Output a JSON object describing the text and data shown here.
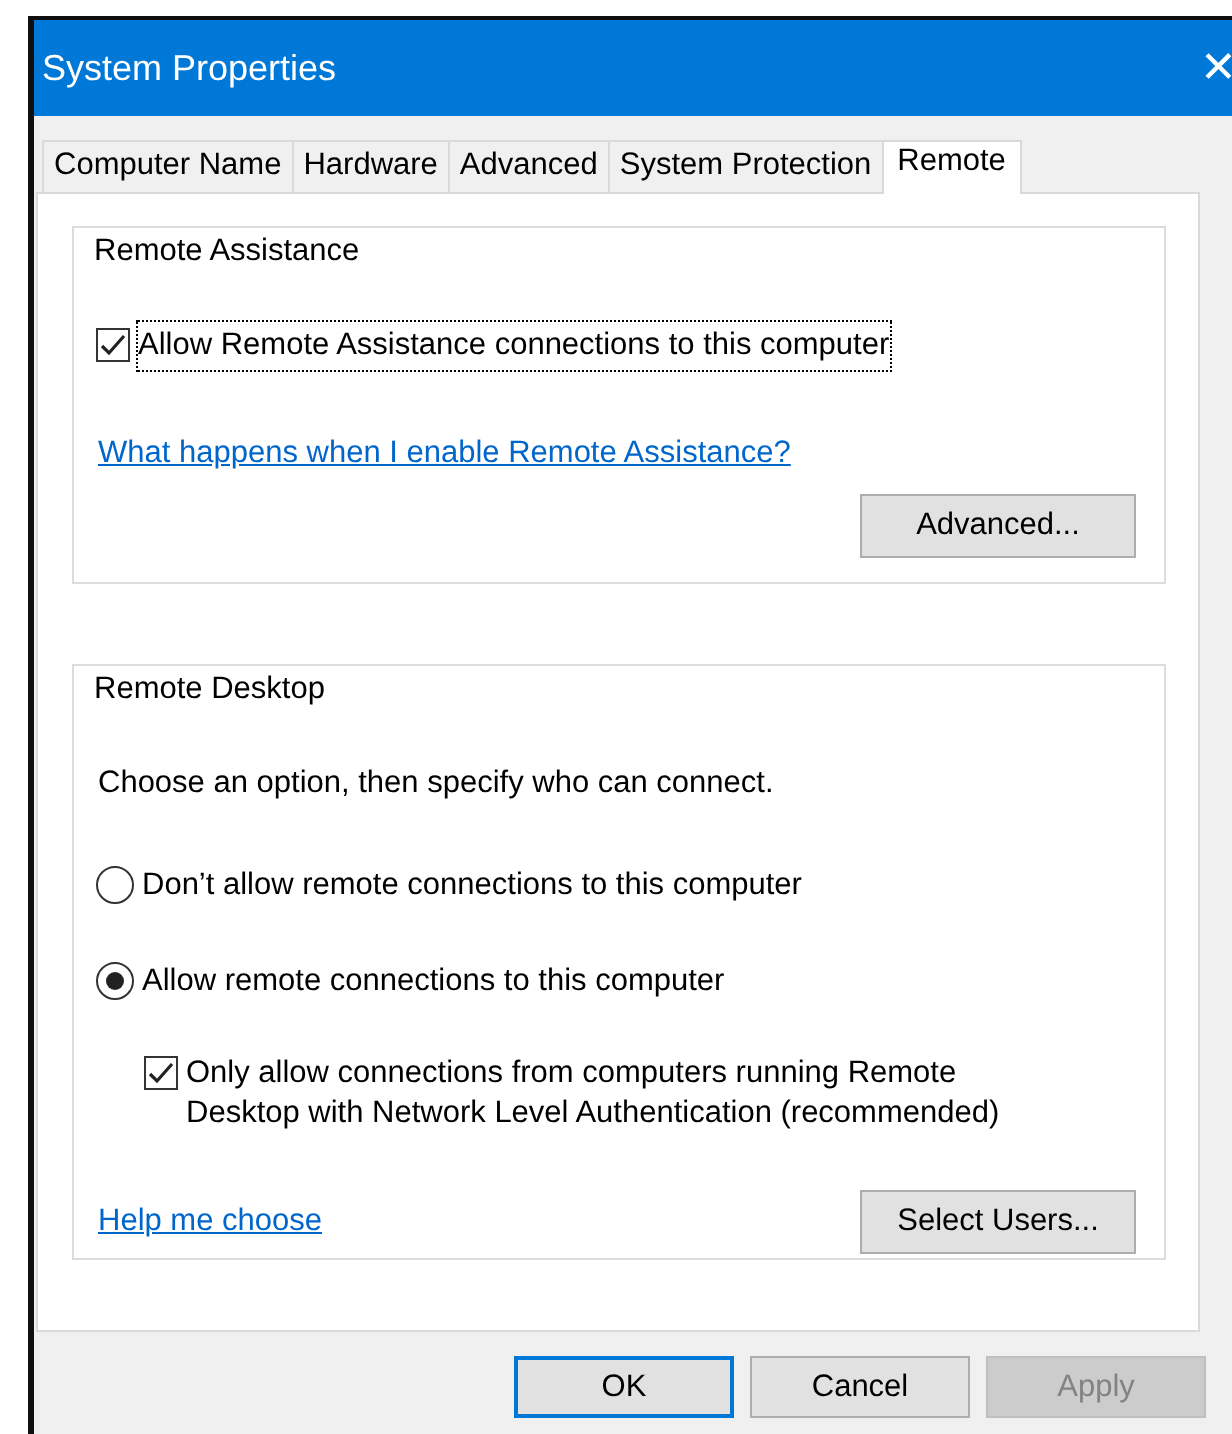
{
  "window": {
    "title": "System Properties",
    "close": "✕"
  },
  "tabs": [
    {
      "label": "Computer Name",
      "selected": false
    },
    {
      "label": "Hardware",
      "selected": false
    },
    {
      "label": "Advanced",
      "selected": false
    },
    {
      "label": "System Protection",
      "selected": false
    },
    {
      "label": "Remote",
      "selected": true
    }
  ],
  "remote_assistance": {
    "title": "Remote Assistance",
    "allow": {
      "label": "Allow Remote Assistance connections to this computer",
      "checked": true
    },
    "link": "What happens when I enable Remote Assistance?",
    "button": "Advanced..."
  },
  "remote_desktop": {
    "title": "Remote Desktop",
    "intro": "Choose an option, then specify who can connect.",
    "options": [
      {
        "label": "Don’t allow remote connections to this computer",
        "selected": false
      },
      {
        "label": "Allow remote connections to this computer",
        "selected": true
      }
    ],
    "nla": {
      "label": "Only allow connections from computers running Remote Desktop with Network Level Authentication (recommended)",
      "checked": true
    },
    "link": "Help me choose",
    "button": "Select Users..."
  },
  "buttons": [
    {
      "label": "OK",
      "kind": "default",
      "disabled": false
    },
    {
      "label": "Cancel",
      "kind": "normal",
      "disabled": false
    },
    {
      "label": "Apply",
      "kind": "normal",
      "disabled": true
    }
  ]
}
